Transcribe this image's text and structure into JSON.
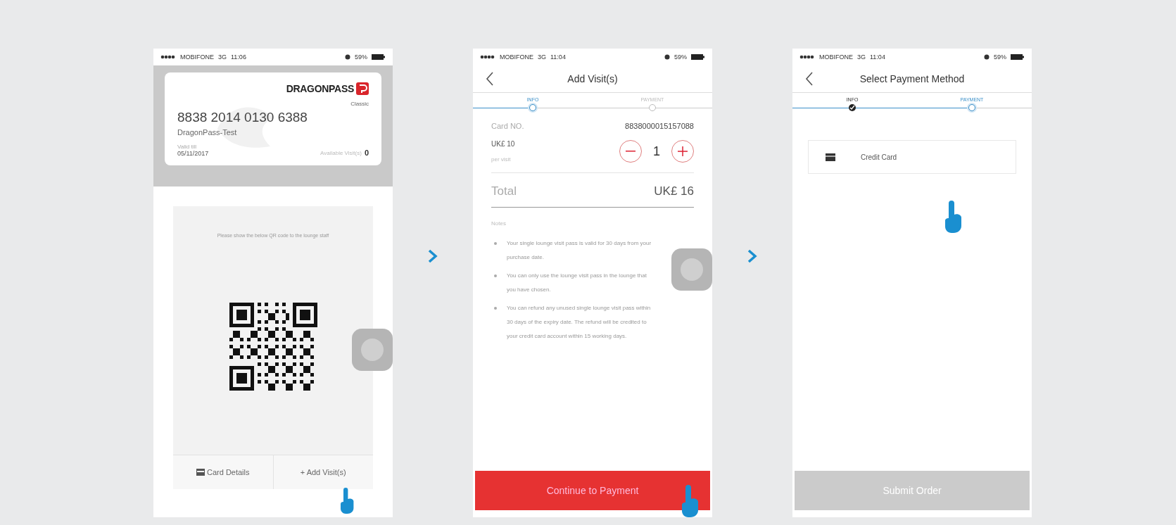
{
  "screens": [
    {
      "kind": "card",
      "status": {
        "carrier": "MOBIFONE",
        "network": "3G",
        "time": "11:06",
        "battery": "59%"
      },
      "card": {
        "brand": "DRAGONPASS",
        "tier": "Classic",
        "number": "8838 2014 0130 6388",
        "holder": "DragonPass-Test",
        "valid_label": "Valid till",
        "valid_date": "05/11/2017",
        "visits_label": "Available Visit(s)",
        "visits": "0"
      },
      "qr_caption": "Please show the below QR code to the lounge staff",
      "actions": [
        {
          "kind": "details",
          "label": "Card Details"
        },
        {
          "kind": "add",
          "label": "+ Add Visit(s)"
        }
      ]
    },
    {
      "kind": "add_visits",
      "status": {
        "carrier": "MOBIFONE",
        "network": "3G",
        "time": "11:04",
        "battery": "59%"
      },
      "title": "Add Visit(s)",
      "steps": [
        {
          "label": "INFO",
          "selected": true,
          "completed": false
        },
        {
          "label": "PAYMENT",
          "selected": false,
          "completed": false
        }
      ],
      "card_label": "Card NO.",
      "card_number": "8838000015157088",
      "price": "UK£ 10",
      "price_unit": "per visit",
      "quantity": "1",
      "total_label": "Total",
      "total": "UK£ 16",
      "notes_title": "Notes",
      "notes": [
        "Your single lounge visit pass is valid for 30 days from your purchase date.",
        "You can only use the lounge visit pass in the lounge that you have chosen.",
        "You can refund any unused single lounge visit pass within 30 days of the expiry date. The refund will be credited to your credit card account within 15 working days."
      ],
      "button": {
        "label": "Continue to Payment",
        "disabled": false
      }
    },
    {
      "kind": "payment",
      "status": {
        "carrier": "MOBIFONE",
        "network": "3G",
        "time": "11:04",
        "battery": "59%"
      },
      "title": "Select Payment Method",
      "steps": [
        {
          "label": "INFO",
          "selected": false,
          "completed": true
        },
        {
          "label": "PAYMENT",
          "selected": true,
          "completed": false
        }
      ],
      "methods": [
        {
          "label": "Credit Card"
        }
      ],
      "button": {
        "label": "Submit Order",
        "disabled": true
      }
    }
  ]
}
